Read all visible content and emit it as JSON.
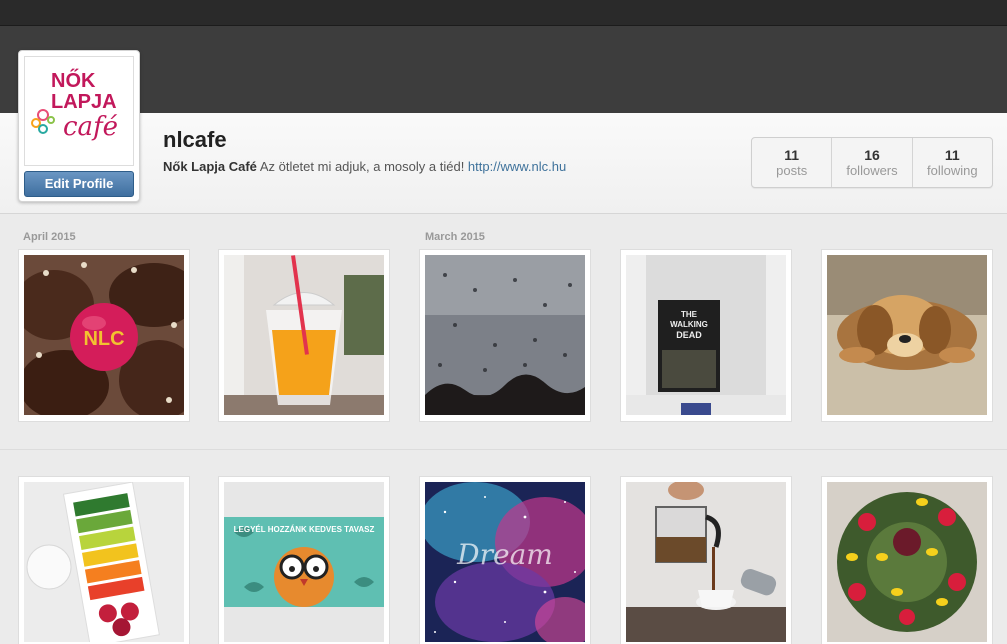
{
  "profile": {
    "username": "nlcafe",
    "full_name": "Nők Lapja Café",
    "bio_text": " Az ötletet mi adjuk, a mosoly a tiéd! ",
    "website": "http://www.nlc.hu",
    "edit_label": "Edit Profile",
    "logo": {
      "line1": "NŐK",
      "line2": "LAPJA",
      "line3": "café"
    }
  },
  "stats": [
    {
      "value": "11",
      "label": "posts"
    },
    {
      "value": "16",
      "label": "followers"
    },
    {
      "value": "11",
      "label": "following"
    }
  ],
  "months": [
    "April 2015",
    "March 2015"
  ],
  "photos": [
    {
      "icon": "bread-photo",
      "text": "NLC"
    },
    {
      "icon": "juice-photo"
    },
    {
      "icon": "rain-photo"
    },
    {
      "icon": "poster-photo",
      "text1": "THE",
      "text2": "WALKING",
      "text3": "DEAD"
    },
    {
      "icon": "puppy-photo"
    },
    {
      "icon": "vegetables-photo"
    },
    {
      "icon": "owl-illustration",
      "text": "LEGYÉL HOZZÁNK KEDVES TAVASZ"
    },
    {
      "icon": "galaxy-photo",
      "text": "Dream"
    },
    {
      "icon": "coffee-photo"
    },
    {
      "icon": "easter-wreath-photo"
    }
  ],
  "colors": {
    "brand": "#c2185b",
    "link": "#3f729b",
    "button": "#4a7aab"
  }
}
